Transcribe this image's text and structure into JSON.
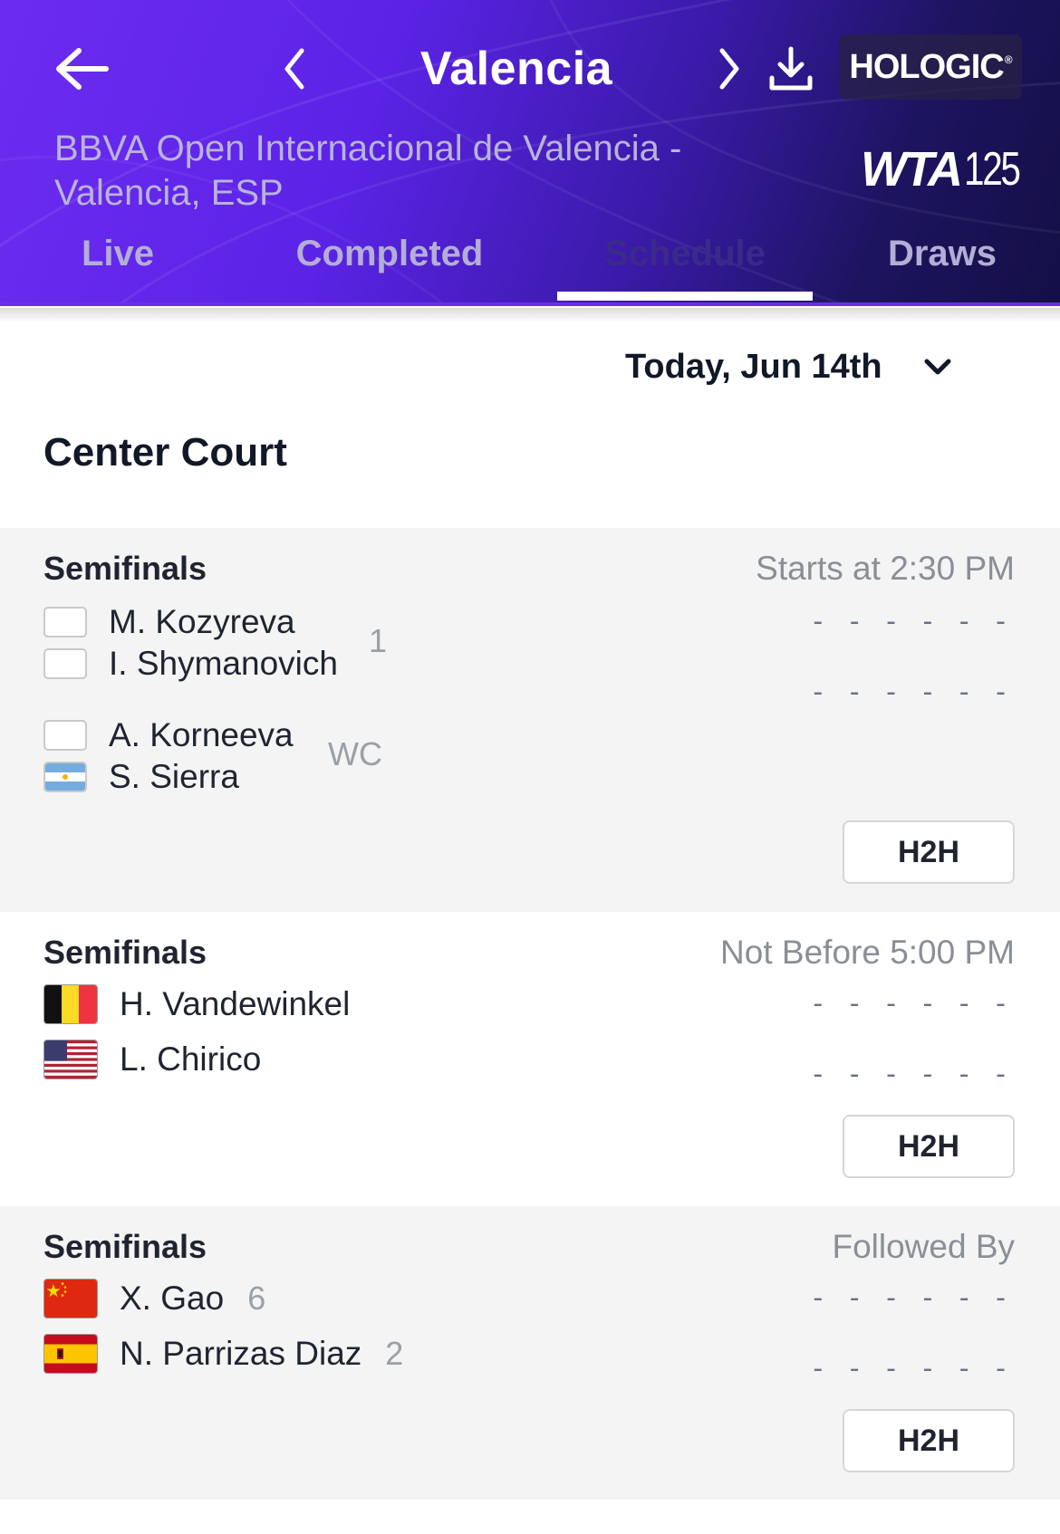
{
  "header": {
    "title": "Valencia",
    "sponsor": "HOLOGIC",
    "sponsor_mark": "®",
    "subtitle": "BBVA Open Internacional de Valencia - Valencia, ESP",
    "tour_logo_text": "WTA",
    "tour_tier": "125",
    "icons": [
      "arrow-left-icon",
      "chevron-left-icon",
      "chevron-right-icon",
      "download-icon"
    ],
    "colors": {
      "gradient_start": "#6d2cf0",
      "gradient_end": "#140f45",
      "accent": "#6a2fe6"
    }
  },
  "tabs": [
    {
      "label": "Live",
      "active": false
    },
    {
      "label": "Completed",
      "active": false
    },
    {
      "label": "Schedule",
      "active": true
    },
    {
      "label": "Draws",
      "active": false
    }
  ],
  "date_selector": {
    "label": "Today, Jun 14th",
    "icon": "chevron-down-icon"
  },
  "court": {
    "name": "Center Court"
  },
  "matches": [
    {
      "round": "Semifinals",
      "status": "Starts at 2:30 PM",
      "team1": {
        "players": [
          "M. Kozyreva",
          "I. Shymanovich"
        ],
        "flags": [
          "none",
          "none"
        ],
        "seed": "1",
        "score": "- - - - - -"
      },
      "team2": {
        "players": [
          "A. Korneeva",
          "S. Sierra"
        ],
        "flags": [
          "none",
          "argentina"
        ],
        "seed": "WC",
        "score": "- - - - - -"
      },
      "h2h_label": "H2H"
    },
    {
      "round": "Semifinals",
      "status": "Not Before 5:00 PM",
      "player1": {
        "name": "H. Vandewinkel",
        "flag": "belgium",
        "seed": "",
        "score": "- - - - - -"
      },
      "player2": {
        "name": "L. Chirico",
        "flag": "usa",
        "seed": "",
        "score": "- - - - - -"
      },
      "h2h_label": "H2H"
    },
    {
      "round": "Semifinals",
      "status": "Followed By",
      "player1": {
        "name": "X. Gao",
        "flag": "china",
        "seed": "6",
        "score": "- - - - - -"
      },
      "player2": {
        "name": "N. Parrizas Diaz",
        "flag": "spain",
        "seed": "2",
        "score": "- - - - - -"
      },
      "h2h_label": "H2H"
    }
  ]
}
